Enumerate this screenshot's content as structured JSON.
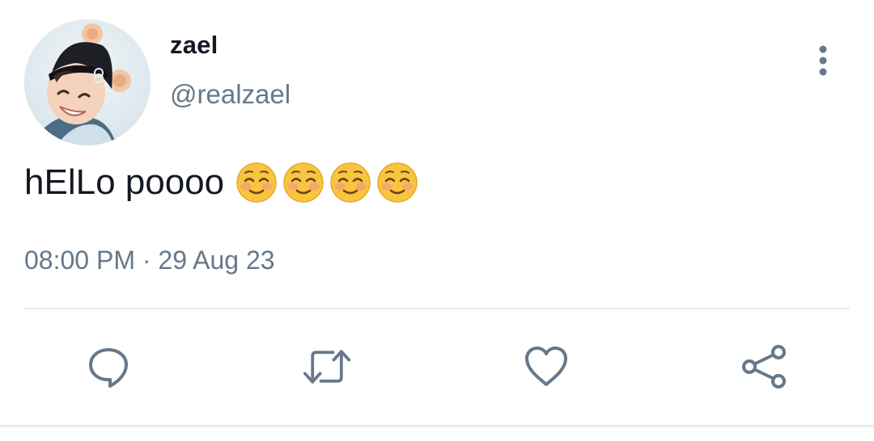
{
  "user": {
    "display_name": "zael",
    "handle": "@realzael",
    "avatar_icon": "profile-photo"
  },
  "tweet": {
    "text": "hElLo poooo",
    "emojis": [
      "smiling-face-emoji",
      "smiling-face-emoji",
      "smiling-face-emoji",
      "smiling-face-emoji"
    ],
    "time": "08:00 PM",
    "separator": "·",
    "date": "29 Aug 23"
  },
  "actions": [
    {
      "name": "reply",
      "icon": "comment-icon"
    },
    {
      "name": "retweet",
      "icon": "retweet-icon"
    },
    {
      "name": "like",
      "icon": "heart-icon"
    },
    {
      "name": "share",
      "icon": "share-icon"
    }
  ],
  "colors": {
    "text": "#141823",
    "secondary": "#66788a",
    "icon": "#66788a",
    "divider": "#e6ecf0"
  }
}
